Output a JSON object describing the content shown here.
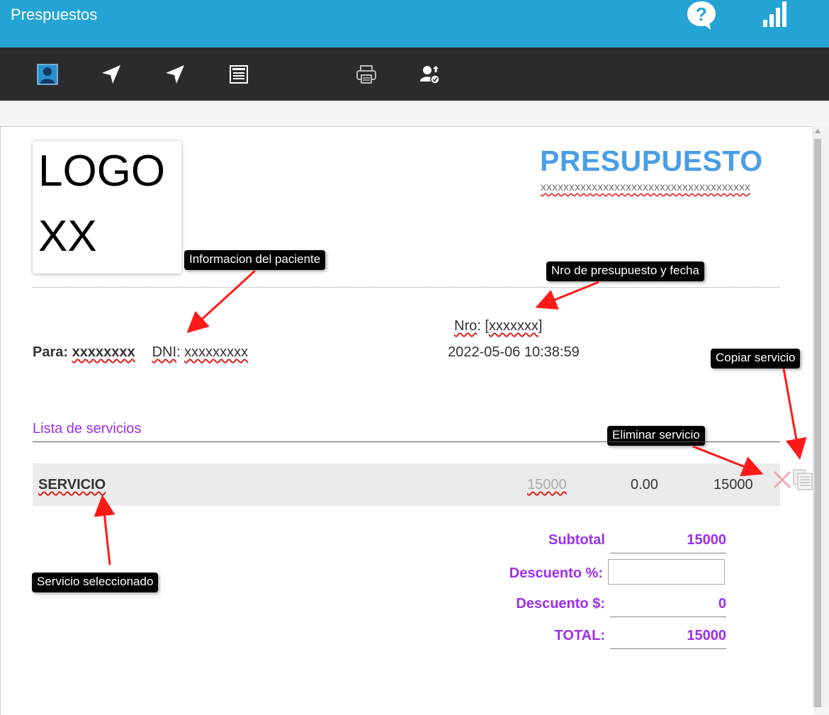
{
  "header": {
    "title": "Prespuestos",
    "help_icon": "help-bubble-icon",
    "stats_icon": "signal-bars-icon",
    "bg_color": "#24a4d4"
  },
  "toolbar": {
    "bg_color": "#2b2b2b",
    "buttons": [
      {
        "name": "patient",
        "icon": "person-icon",
        "active": true
      },
      {
        "name": "navigate-1",
        "icon": "navigation-arrow-icon"
      },
      {
        "name": "navigate-2",
        "icon": "navigation-arrow-icon"
      },
      {
        "name": "list",
        "icon": "document-list-icon"
      },
      {
        "name": "print",
        "icon": "printer-icon"
      },
      {
        "name": "user-upload",
        "icon": "user-settings-icon"
      }
    ]
  },
  "document": {
    "logo_line1": "LOGO",
    "logo_line2": "XX",
    "title": "PRESUPUESTO",
    "subtitle": "xxxxxxxxxxxxxxxxxxxxxxxxxxxxxxxxxxxxx",
    "nro_label": "Nro",
    "nro_sep": ": [",
    "nro_value": "xxxxxxx",
    "nro_end": "]",
    "date": "2022-05-06 10:38:59",
    "para_label": "Para:",
    "para_value": "xxxxxxxx",
    "dni_label": "DNI",
    "dni_sep": ": ",
    "dni_value": "xxxxxxxxx",
    "services_title": "Lista de servicios",
    "services": [
      {
        "name": "SERVICIO",
        "price": "15000",
        "discount": "0.00",
        "total": "15000"
      }
    ],
    "summary": {
      "subtotal_label": "Subtotal",
      "subtotal_value": "15000",
      "desc_pct_label": "Descuento %:",
      "desc_pct_value": "",
      "desc_amt_label": "Descuento $:",
      "desc_amt_value": "0",
      "total_label": "TOTAL:",
      "total_value": "15000"
    },
    "accent_color": "#9b2ff0",
    "title_color": "#4a9de6"
  },
  "tooltips": {
    "patient_info": "Informacion del paciente",
    "nro_fecha": "Nro de presupuesto y fecha",
    "copiar": "Copiar servicio",
    "eliminar": "Eliminar servicio",
    "seleccionado": "Servicio seleccionado"
  }
}
